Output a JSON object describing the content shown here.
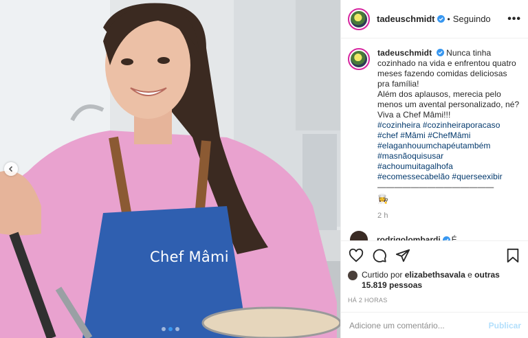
{
  "header": {
    "username": "tadeuschmidt",
    "separator": "•",
    "follow_status": "Seguindo",
    "more": "•••"
  },
  "caption": {
    "username": "tadeuschmidt",
    "text_line1": "Nunca tinha cozinhado na vida e enfrentou quatro meses fazendo comidas deliciosas pra família!",
    "text_line2": "Além dos aplausos, merecia pelo menos um avental personalizado, né?",
    "text_line3": "Viva a Chef Mâmi!!!",
    "hashtags": [
      "#cozinheira #cozinheiraporacaso",
      "#chef #Mâmi #ChefMâmi",
      "#elaganhouumchapéutambém",
      "#masnãoquisusar",
      "#achoumuitagalhofa",
      "#ecomessecabelão #querseexibir"
    ],
    "rule": "——————————————",
    "emoji": "👩‍🍳",
    "time": "2 h"
  },
  "comment": {
    "username": "rodrigolombardi",
    "trail": "É",
    "more": "..."
  },
  "likes": {
    "prefix": "Curtido por",
    "user": "elizabethsavala",
    "conj": "e",
    "others": "outras 15.819 pessoas"
  },
  "timestamp": "HÁ 2 HORAS",
  "add_comment": {
    "placeholder": "Adicione um comentário...",
    "publish": "Publicar"
  },
  "photo": {
    "apron_text": "Chef Mâmi"
  },
  "colors": {
    "accent": "#3897f0",
    "hashtag": "#00376b",
    "muted": "#8e8e8e",
    "publish_disabled": "#b2dffc",
    "apron": "#2f5fb0",
    "shirt": "#e9a2cf"
  }
}
